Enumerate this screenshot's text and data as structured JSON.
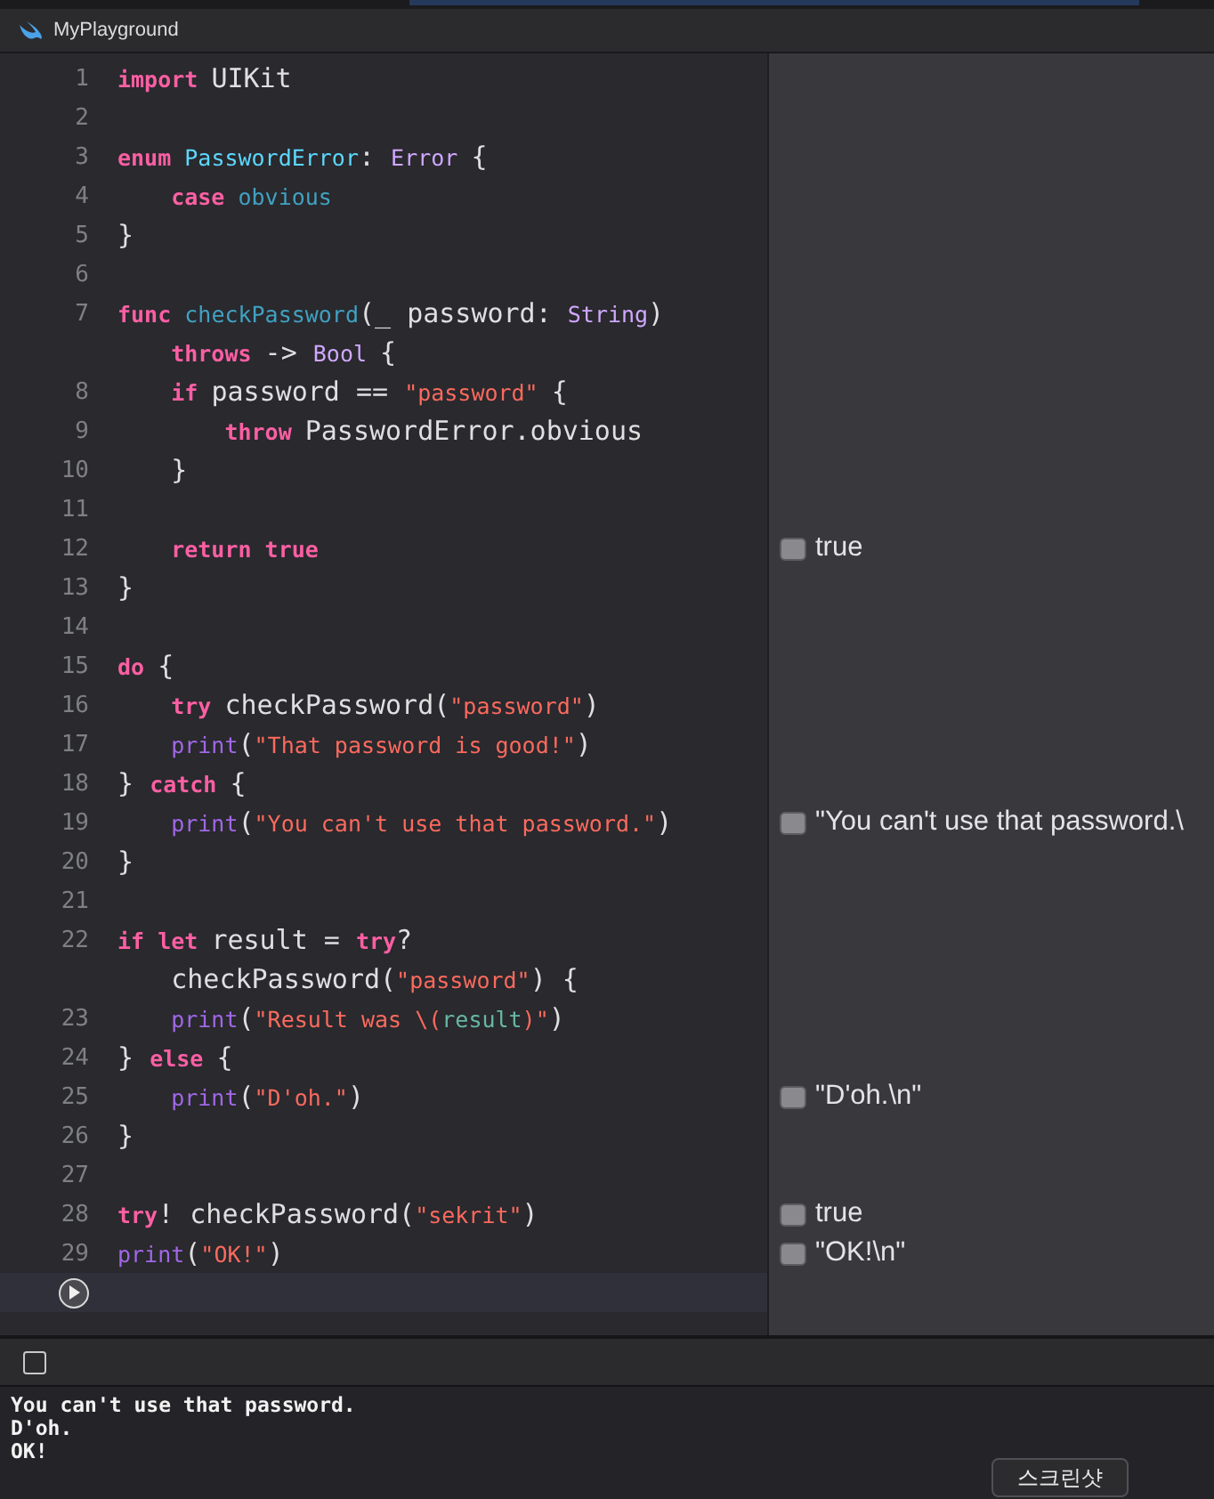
{
  "window": {
    "title": "MyPlayground"
  },
  "editor": {
    "lines": [
      {
        "number": "1",
        "segments": [
          {
            "tokens": [
              {
                "kind": "kw",
                "text": "import "
              },
              {
                "kind": "id",
                "text": "UIKit"
              }
            ]
          }
        ]
      },
      {
        "number": "2"
      },
      {
        "number": "3",
        "segments": [
          {
            "tokens": [
              {
                "kind": "kw",
                "text": "enum "
              },
              {
                "kind": "decl",
                "text": "PasswordError"
              },
              {
                "kind": "id",
                "text": ": "
              },
              {
                "kind": "type",
                "text": "Error "
              },
              {
                "kind": "id",
                "text": "{"
              }
            ]
          }
        ]
      },
      {
        "number": "4",
        "segments": [
          {
            "tokens": [
              {
                "kind": "kw",
                "text": "    case "
              },
              {
                "kind": "fn",
                "text": "obvious"
              }
            ]
          }
        ]
      },
      {
        "number": "5",
        "segments": [
          {
            "tokens": [
              {
                "kind": "id",
                "text": "}"
              }
            ]
          }
        ]
      },
      {
        "number": "6"
      },
      {
        "number": "7",
        "segments": [
          {
            "tokens": [
              {
                "kind": "kw",
                "text": "func "
              },
              {
                "kind": "fn",
                "text": "checkPassword"
              },
              {
                "kind": "id",
                "text": "(_ password: "
              },
              {
                "kind": "type",
                "text": "String"
              },
              {
                "kind": "id",
                "text": ")"
              }
            ]
          },
          {
            "tokens": [
              {
                "kind": "kw",
                "text": "    throws "
              },
              {
                "kind": "id",
                "text": "-> "
              },
              {
                "kind": "type",
                "text": "Bool "
              },
              {
                "kind": "id",
                "text": "{"
              }
            ]
          }
        ]
      },
      {
        "number": "8",
        "segments": [
          {
            "tokens": [
              {
                "kind": "kw",
                "text": "    if "
              },
              {
                "kind": "id",
                "text": "password == "
              },
              {
                "kind": "str",
                "text": "\"password\" "
              },
              {
                "kind": "id",
                "text": "{"
              }
            ]
          }
        ]
      },
      {
        "number": "9",
        "segments": [
          {
            "tokens": [
              {
                "kind": "kw",
                "text": "        throw "
              },
              {
                "kind": "id",
                "text": "PasswordError.obvious"
              }
            ]
          }
        ]
      },
      {
        "number": "10",
        "segments": [
          {
            "tokens": [
              {
                "kind": "id",
                "text": "    }"
              }
            ]
          }
        ]
      },
      {
        "number": "11"
      },
      {
        "number": "12",
        "segments": [
          {
            "tokens": [
              {
                "kind": "kw",
                "text": "    return true"
              }
            ]
          }
        ],
        "result": "true"
      },
      {
        "number": "13",
        "segments": [
          {
            "tokens": [
              {
                "kind": "id",
                "text": "}"
              }
            ]
          }
        ]
      },
      {
        "number": "14"
      },
      {
        "number": "15",
        "segments": [
          {
            "tokens": [
              {
                "kind": "kw",
                "text": "do "
              },
              {
                "kind": "id",
                "text": "{"
              }
            ]
          }
        ]
      },
      {
        "number": "16",
        "segments": [
          {
            "tokens": [
              {
                "kind": "kw",
                "text": "    try "
              },
              {
                "kind": "id",
                "text": "checkPassword("
              },
              {
                "kind": "str",
                "text": "\"password\""
              },
              {
                "kind": "id",
                "text": ")"
              }
            ]
          }
        ]
      },
      {
        "number": "17",
        "segments": [
          {
            "tokens": [
              {
                "kind": "call",
                "text": "    print"
              },
              {
                "kind": "id",
                "text": "("
              },
              {
                "kind": "str",
                "text": "\"That password is good!\""
              },
              {
                "kind": "id",
                "text": ")"
              }
            ]
          }
        ]
      },
      {
        "number": "18",
        "segments": [
          {
            "tokens": [
              {
                "kind": "id",
                "text": "} "
              },
              {
                "kind": "kw",
                "text": "catch "
              },
              {
                "kind": "id",
                "text": "{"
              }
            ]
          }
        ]
      },
      {
        "number": "19",
        "segments": [
          {
            "tokens": [
              {
                "kind": "call",
                "text": "    print"
              },
              {
                "kind": "id",
                "text": "("
              },
              {
                "kind": "str",
                "text": "\"You can't use that password.\""
              },
              {
                "kind": "id",
                "text": ")"
              }
            ]
          }
        ],
        "result": "\"You can't use that password.\\"
      },
      {
        "number": "20",
        "segments": [
          {
            "tokens": [
              {
                "kind": "id",
                "text": "}"
              }
            ]
          }
        ]
      },
      {
        "number": "21"
      },
      {
        "number": "22",
        "segments": [
          {
            "tokens": [
              {
                "kind": "kw",
                "text": "if let "
              },
              {
                "kind": "id",
                "text": "result = "
              },
              {
                "kind": "kw",
                "text": "try"
              },
              {
                "kind": "id",
                "text": "?"
              }
            ]
          },
          {
            "tokens": [
              {
                "kind": "id",
                "text": "    checkPassword("
              },
              {
                "kind": "str",
                "text": "\"password\""
              },
              {
                "kind": "id",
                "text": ") {"
              }
            ]
          }
        ]
      },
      {
        "number": "23",
        "segments": [
          {
            "tokens": [
              {
                "kind": "call",
                "text": "    print"
              },
              {
                "kind": "id",
                "text": "("
              },
              {
                "kind": "str",
                "text": "\"Result was \\("
              },
              {
                "kind": "interp",
                "text": "result"
              },
              {
                "kind": "str",
                "text": ")\""
              },
              {
                "kind": "id",
                "text": ")"
              }
            ]
          }
        ]
      },
      {
        "number": "24",
        "segments": [
          {
            "tokens": [
              {
                "kind": "id",
                "text": "} "
              },
              {
                "kind": "kw",
                "text": "else "
              },
              {
                "kind": "id",
                "text": "{"
              }
            ]
          }
        ]
      },
      {
        "number": "25",
        "segments": [
          {
            "tokens": [
              {
                "kind": "call",
                "text": "    print"
              },
              {
                "kind": "id",
                "text": "("
              },
              {
                "kind": "str",
                "text": "\"D'oh.\""
              },
              {
                "kind": "id",
                "text": ")"
              }
            ]
          }
        ],
        "result": "\"D'oh.\\n\""
      },
      {
        "number": "26",
        "segments": [
          {
            "tokens": [
              {
                "kind": "id",
                "text": "}"
              }
            ]
          }
        ]
      },
      {
        "number": "27"
      },
      {
        "number": "28",
        "segments": [
          {
            "tokens": [
              {
                "kind": "kw",
                "text": "try"
              },
              {
                "kind": "id",
                "text": "! checkPassword("
              },
              {
                "kind": "str",
                "text": "\"sekrit\""
              },
              {
                "kind": "id",
                "text": ")"
              }
            ]
          }
        ],
        "result": "true"
      },
      {
        "number": "29",
        "segments": [
          {
            "tokens": [
              {
                "kind": "call",
                "text": "print"
              },
              {
                "kind": "id",
                "text": "("
              },
              {
                "kind": "str",
                "text": "\"OK!\""
              },
              {
                "kind": "id",
                "text": ")"
              }
            ]
          }
        ],
        "result": "\"OK!\\n\""
      }
    ]
  },
  "console": {
    "lines": [
      "You can't use that password.",
      "D'oh.",
      "OK!"
    ]
  },
  "overlay_button": {
    "label": "스크린샷"
  }
}
